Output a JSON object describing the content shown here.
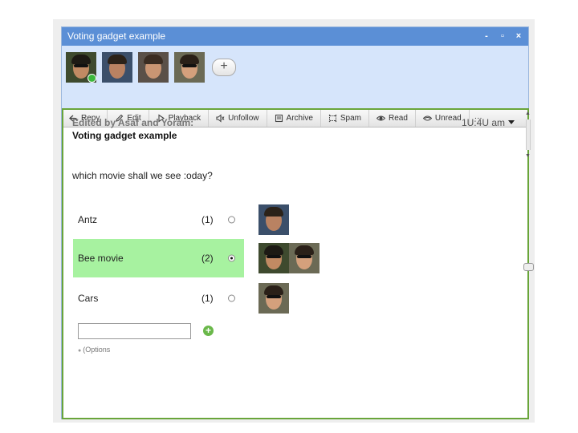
{
  "window": {
    "title": "Voting gadget example",
    "controls": [
      "-",
      "▫",
      "×"
    ]
  },
  "participants": [
    {
      "name": "participant-1",
      "bg": "#3e4a2e",
      "face": "#c18a63",
      "hair": "#1d1a14",
      "glasses": true,
      "online": true
    },
    {
      "name": "participant-2",
      "bg": "#3b4f6a",
      "face": "#b98262",
      "hair": "#2b2219",
      "glasses": false,
      "online": false
    },
    {
      "name": "participant-3",
      "bg": "#5a5048",
      "face": "#c99573",
      "hair": "#3a2c22",
      "glasses": false,
      "online": false
    },
    {
      "name": "participant-4",
      "bg": "#6b6a55",
      "face": "#d4a07c",
      "hair": "#2a2018",
      "glasses": true,
      "online": false
    }
  ],
  "add_participant_label": "+",
  "toolbar": [
    {
      "id": "reply",
      "label": "Repy",
      "icon": "reply-icon"
    },
    {
      "id": "edit",
      "label": "Edit",
      "icon": "pencil-icon"
    },
    {
      "id": "playback",
      "label": "Playback",
      "icon": "play-icon"
    },
    {
      "id": "unfollow",
      "label": "Unfollow",
      "icon": "mute-icon"
    },
    {
      "id": "archive",
      "label": "Archive",
      "icon": "archive-icon"
    },
    {
      "id": "spam",
      "label": "Spam",
      "icon": "spam-icon"
    },
    {
      "id": "read",
      "label": "Read",
      "icon": "eye-icon"
    },
    {
      "id": "unread",
      "label": "Unread",
      "icon": "eye-closed-icon"
    },
    {
      "id": "more",
      "label": "···",
      "icon": "more-icon"
    }
  ],
  "blip": {
    "edited_by": "Edited by Asaf and Yoram:",
    "time": "1U:4U am",
    "title": "Voting gadget example",
    "question": "which movie shall we see :oday?"
  },
  "options": [
    {
      "label": "Antz",
      "count": "(1)",
      "selected": false,
      "voters": [
        "participant-2"
      ]
    },
    {
      "label": "Bee movie",
      "count": "(2)",
      "selected": true,
      "voters": [
        "participant-1",
        "participant-4"
      ]
    },
    {
      "label": "Cars",
      "count": "(1)",
      "selected": false,
      "voters": [
        "participant-4"
      ]
    }
  ],
  "new_option": {
    "value": "",
    "add_label": "+"
  },
  "options_link": "(Options",
  "colors": {
    "titlebar": "#5b8fd6",
    "participant_bar": "#d6e5fb",
    "selected_row": "#a7f2a0",
    "border": "#69a53a"
  }
}
